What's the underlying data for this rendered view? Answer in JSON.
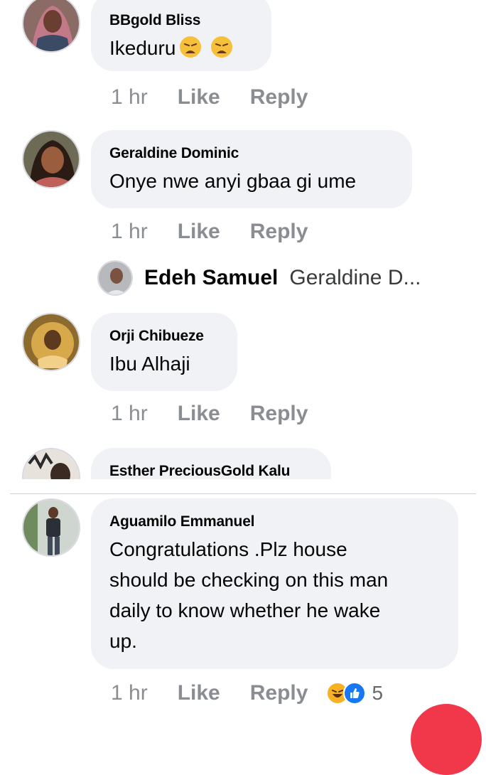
{
  "comments": [
    {
      "name": "BBgold Bliss",
      "text": "Ikeduru",
      "time": "1 hr",
      "like": "Like",
      "reply": "Reply"
    },
    {
      "name": "Geraldine Dominic",
      "text": "Onye nwe anyi gbaa gi ume",
      "time": "1 hr",
      "like": "Like",
      "reply": "Reply"
    },
    {
      "name": "Orji Chibueze",
      "text": "Ibu Alhaji",
      "time": "1 hr",
      "like": "Like",
      "reply": "Reply"
    },
    {
      "name": "Esther PreciousGold Kalu"
    },
    {
      "name": "Aguamilo Emmanuel",
      "text_lines": [
        "Congratulations .Plz house",
        "should be checking on this man",
        "daily to know whether he wake",
        "up."
      ],
      "time": "1 hr",
      "like": "Like",
      "reply": "Reply",
      "reaction_count": "5"
    }
  ],
  "reply_preview": {
    "name": "Edeh Samuel",
    "text": "Geraldine D..."
  },
  "icons": {
    "emoji_weary": "weary-face-icon",
    "haha": "haha-reaction-icon",
    "like": "like-reaction-icon"
  },
  "colors": {
    "bubble": "#f0f2f5",
    "meta": "#8a8d91",
    "like_blue": "#1877f2",
    "haha_yellow": "#f7b125",
    "fab_red": "#f0384a"
  }
}
